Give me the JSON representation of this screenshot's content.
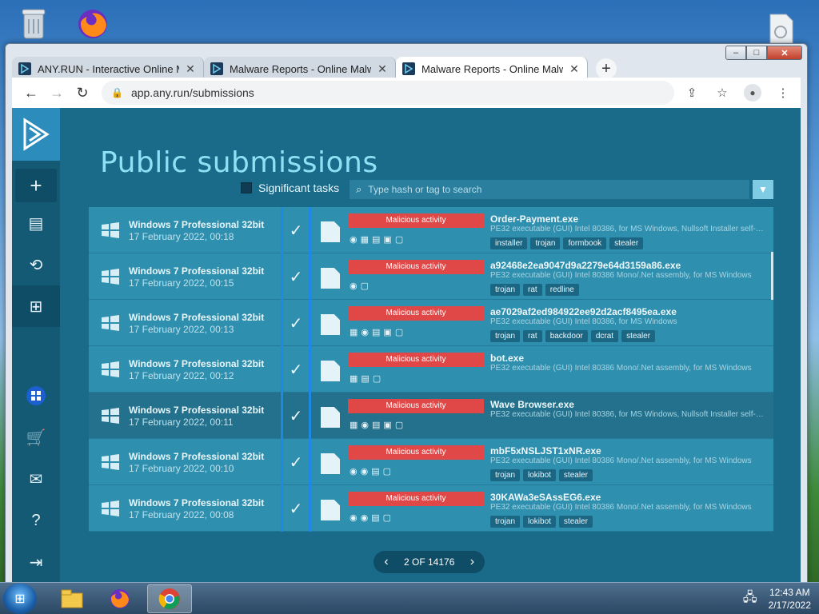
{
  "browser": {
    "tabs": [
      {
        "title": "ANY.RUN - Interactive Online Ma",
        "active": false
      },
      {
        "title": "Malware Reports - Online Malwa",
        "active": false
      },
      {
        "title": "Malware Reports - Online Malwa",
        "active": true
      }
    ],
    "url": "app.any.run/submissions",
    "window_controls": {
      "minimize": "–",
      "maximize": "□",
      "close": "✕"
    }
  },
  "page": {
    "title": "Public submissions",
    "significant_tasks_label": "Significant tasks",
    "search_placeholder": "Type hash or tag to search",
    "pagination": "2 OF 14176"
  },
  "submissions": [
    {
      "os": "Windows 7 Professional 32bit",
      "date": "17 February 2022, 00:18",
      "verdict": "Malicious activity",
      "file": "Order-Payment.exe",
      "desc": "PE32 executable (GUI) Intel 80386, for MS Windows, Nullsoft Installer self-e...",
      "tags": [
        "installer",
        "trojan",
        "formbook",
        "stealer"
      ]
    },
    {
      "os": "Windows 7 Professional 32bit",
      "date": "17 February 2022, 00:15",
      "verdict": "Malicious activity",
      "file": "a92468e2ea9047d9a2279e64d3159a86.exe",
      "desc": "PE32 executable (GUI) Intel 80386 Mono/.Net assembly, for MS Windows",
      "tags": [
        "trojan",
        "rat",
        "redline"
      ]
    },
    {
      "os": "Windows 7 Professional 32bit",
      "date": "17 February 2022, 00:13",
      "verdict": "Malicious activity",
      "file": "ae7029af2ed984922ee92d2acf8495ea.exe",
      "desc": "PE32 executable (GUI) Intel 80386, for MS Windows",
      "tags": [
        "trojan",
        "rat",
        "backdoor",
        "dcrat",
        "stealer"
      ]
    },
    {
      "os": "Windows 7 Professional 32bit",
      "date": "17 February 2022, 00:12",
      "verdict": "Malicious activity",
      "file": "bot.exe",
      "desc": "PE32 executable (GUI) Intel 80386 Mono/.Net assembly, for MS Windows",
      "tags": []
    },
    {
      "os": "Windows 7 Professional 32bit",
      "date": "17 February 2022, 00:11",
      "verdict": "Malicious activity",
      "file": "Wave Browser.exe",
      "desc": "PE32 executable (GUI) Intel 80386, for MS Windows, Nullsoft Installer self-e...",
      "tags": []
    },
    {
      "os": "Windows 7 Professional 32bit",
      "date": "17 February 2022, 00:10",
      "verdict": "Malicious activity",
      "file": "mbF5xNSLJST1xNR.exe",
      "desc": "PE32 executable (GUI) Intel 80386 Mono/.Net assembly, for MS Windows",
      "tags": [
        "trojan",
        "lokibot",
        "stealer"
      ]
    },
    {
      "os": "Windows 7 Professional 32bit",
      "date": "17 February 2022, 00:08",
      "verdict": "Malicious activity",
      "file": "30KAWa3eSAssEG6.exe",
      "desc": "PE32 executable (GUI) Intel 80386 Mono/.Net assembly, for MS Windows",
      "tags": [
        "trojan",
        "lokibot",
        "stealer"
      ]
    }
  ],
  "taskbar": {
    "time": "12:43 AM",
    "date": "2/17/2022"
  },
  "colors": {
    "page_bg": "#1a6b8a",
    "row_bg": "#2f8fae",
    "malicious": "#e04848",
    "title": "#8fe0f4"
  }
}
